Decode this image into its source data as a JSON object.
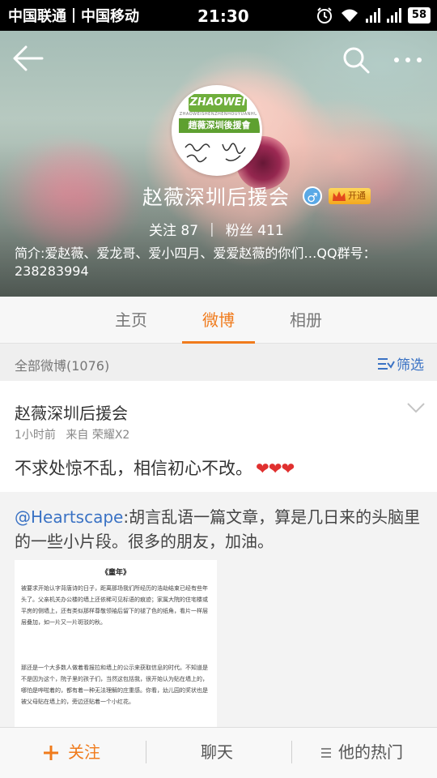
{
  "status_bar": {
    "carrier1": "中国联通",
    "carrier2": "中国移动",
    "time": "21:30",
    "battery": "58"
  },
  "profile": {
    "avatar_brand_top": "ZHAOWEI",
    "avatar_brand_sub": "ZHAOWEISHENZHENHOUYUANHUI",
    "avatar_brand_bar": "趙薇深圳後援會",
    "name": "赵薇深圳后援会",
    "gender": "♂",
    "vip_label": "开通",
    "following_label": "关注",
    "following_count": "87",
    "followers_label": "粉丝",
    "followers_count": "411",
    "intro": "简介:爱赵薇、爱龙哥、爱小四月、爱爱赵薇的你们…QQ群号：238283994"
  },
  "tabs": [
    {
      "label": "主页"
    },
    {
      "label": "微博",
      "active": true
    },
    {
      "label": "相册"
    }
  ],
  "filter": {
    "title": "全部微博(1076)",
    "button": "筛选"
  },
  "post": {
    "author": "赵薇深圳后援会",
    "time": "1小时前",
    "source": "来自 荣耀X2",
    "text": "不求处惊不乱，相信初心不改。",
    "hearts": "❤❤❤",
    "repost": {
      "mention": "@Heartscape",
      "text": ":胡言乱语一篇文章，算是几日来的头脑里的一些小片段。很多的朋友，加油。",
      "image": {
        "title": "《童年》",
        "para1": "被要求开始认字背唐诗的日子，距离那场我们所经历的浩劫结束已经有些年头了。父亲机关办公楼的墙上还依稀可见标语的痕迹；家属大院的住宅楼或平房的侧墙上，还有类似那样尊敬领袖后留下的褪了色的纸角，看片一样层层叠加，如一片又一片斑驳的秋。",
        "para2": "那还是一个大多数人做着看报拉和墙上的公示来获取信息的时代。不知道是不是因为这个，院子里的孩子们，当然这包括我，很开始认为贴在墙上的，哪怕是哗啦着的，都有着一种无法理解的庄重感。你看，幼儿园的奖状也是被父母贴在墙上的，旁边还贴着一个小红花。"
      }
    }
  },
  "bottom_bar": {
    "follow": "关注",
    "chat": "聊天",
    "hot": "他的热门"
  },
  "colors": {
    "accent": "#f07b1c",
    "link": "#3a72c4",
    "heart": "#e0302f"
  },
  "icons": [
    "back-arrow-icon",
    "search-icon",
    "more-icon",
    "wifi-icon",
    "alarm-icon",
    "gender-male-icon",
    "crown-icon",
    "filter-icon",
    "chevron-down-icon",
    "plus-icon",
    "menu-icon"
  ]
}
